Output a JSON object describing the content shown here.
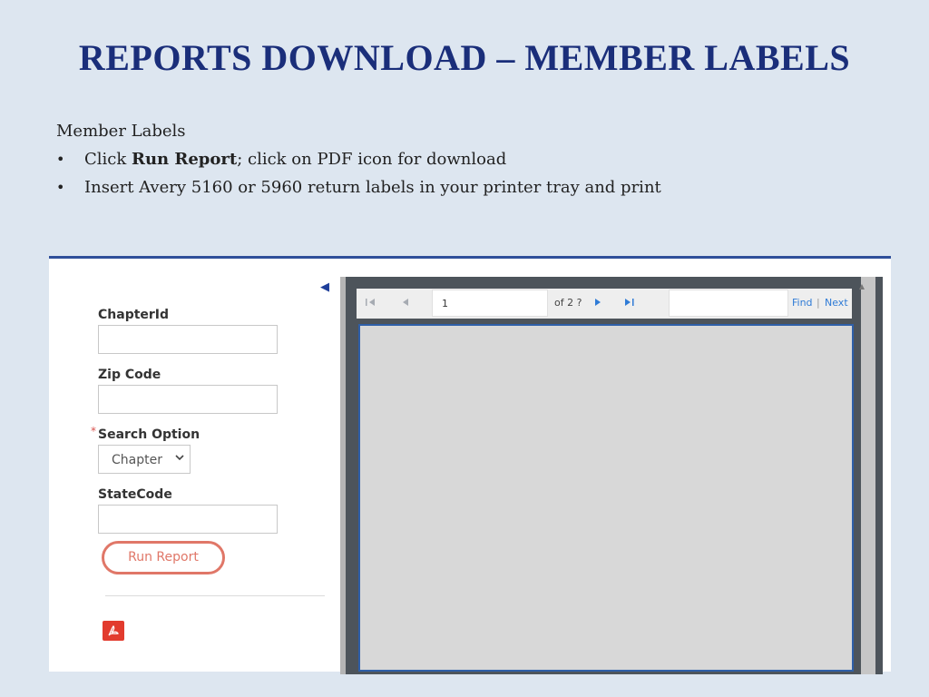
{
  "slide": {
    "title": "REPORTS DOWNLOAD – MEMBER LABELS",
    "heading": "Member Labels",
    "bullets": [
      {
        "prefix": "Click ",
        "bold": "Run Report",
        "suffix": "; click on PDF icon for download"
      },
      {
        "text": "Insert Avery 5160 or 5960 return labels in your printer tray and print"
      }
    ]
  },
  "form": {
    "chapter_id_label": "ChapterId",
    "chapter_id_value": "",
    "zip_code_label": "Zip Code",
    "zip_code_value": "",
    "search_option_label": "Search Option",
    "search_option_required_mark": "*",
    "search_option_value": "Chapter",
    "state_code_label": "StateCode",
    "state_code_value": "",
    "run_report_label": "Run Report",
    "collapse_icon": "triangle-left-icon",
    "pdf_icon": "pdf-icon"
  },
  "viewer": {
    "page_number": "1",
    "page_of": "of 2 ?",
    "find_label": "Find",
    "separator": "|",
    "next_label": "Next",
    "find_value": ""
  },
  "colors": {
    "title": "#1a2e7a",
    "accent_blue": "#2f4f9a",
    "run_report": "#e07768",
    "pdf_red": "#e23b2e",
    "link": "#2f7bd6",
    "viewer_bg": "#4d545b"
  }
}
